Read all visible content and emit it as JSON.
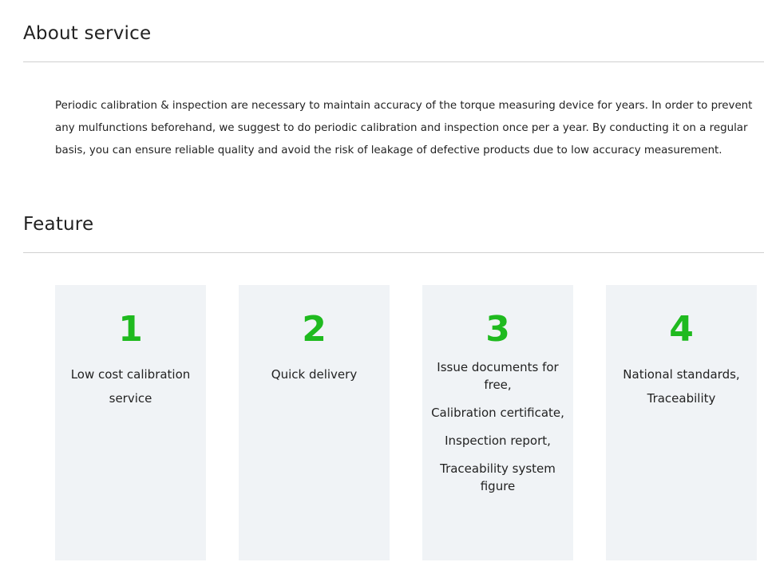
{
  "about": {
    "heading": "About service",
    "body": "Periodic calibration & inspection are necessary to maintain accuracy of the torque measuring device for years. In order to prevent any mulfunctions beforehand, we suggest to do periodic calibration and inspection once per a year. By conducting it on a regular basis, you can ensure reliable quality and avoid the risk of leakage of defective products due to low accuracy measurement."
  },
  "feature": {
    "heading": "Feature",
    "cards": [
      {
        "number": "1",
        "text": "Low cost calibration service"
      },
      {
        "number": "2",
        "text": "Quick delivery"
      },
      {
        "number": "3",
        "items": [
          "Issue documents for free,",
          "Calibration certificate,",
          "Inspection report,",
          "Traceability system figure"
        ]
      },
      {
        "number": "4",
        "text": "National standards, Traceability"
      }
    ]
  },
  "colors": {
    "accent_number": "#1fba1f",
    "card_background": "#f0f3f6",
    "rule": "#d0d0d0"
  }
}
